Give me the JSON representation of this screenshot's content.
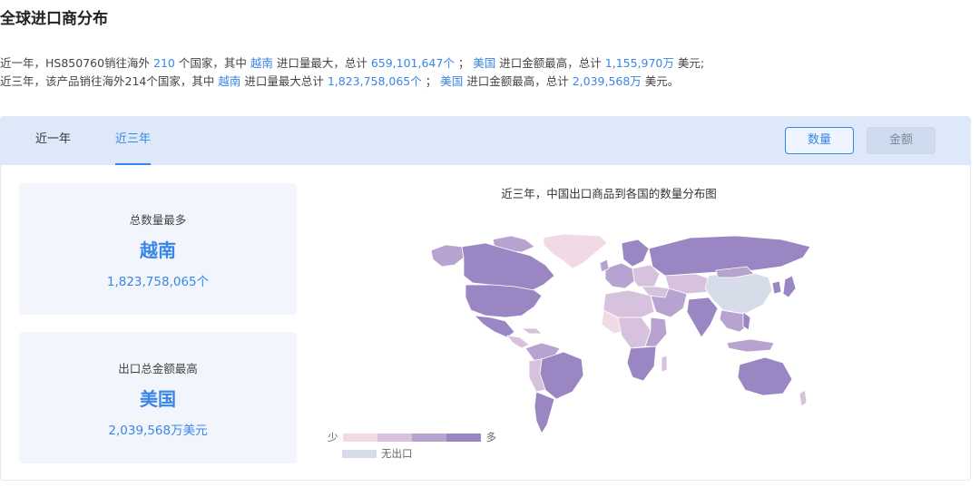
{
  "page": {
    "title": "全球进口商分布"
  },
  "summary": {
    "line1": {
      "p1": "近一年，HS850760销往海外 ",
      "count": "210",
      "p2": " 个国家，其中 ",
      "country_qty": "越南",
      "p3": " 进口量最大，总计 ",
      "qty": "659,101,647个",
      "p4": " ； ",
      "country_amt": "美国",
      "p5": " 进口金额最高，总计 ",
      "amt": "1,155,970万",
      "p6": " 美元;"
    },
    "line2": {
      "p1": "近三年，该产品销往海外214个国家，其中 ",
      "country_qty": "越南",
      "p2": " 进口量最大总计 ",
      "qty": "1,823,758,065个",
      "p3": " ； ",
      "country_amt": "美国",
      "p4": " 进口金额最高，总计 ",
      "amt": "2,039,568万",
      "p5": " 美元。"
    }
  },
  "tabs": [
    {
      "label": "近一年",
      "active": false
    },
    {
      "label": "近三年",
      "active": true
    }
  ],
  "buttons": {
    "quantity": "数量",
    "amount": "金额"
  },
  "cards": [
    {
      "label": "总数量最多",
      "country": "越南",
      "value": "1,823,758,065个"
    },
    {
      "label": "出口总金额最高",
      "country": "美国",
      "value": "2,039,568万美元"
    }
  ],
  "map": {
    "title": "近三年，中国出口商品到各国的数量分布图",
    "colors": {
      "level1": "#f1d9e6",
      "level2": "#d7c2de",
      "level3": "#b8a3d0",
      "level4": "#9a86c2",
      "none": "#d6dce8"
    }
  },
  "legend": {
    "low": "少",
    "high": "多",
    "none": "无出口"
  }
}
